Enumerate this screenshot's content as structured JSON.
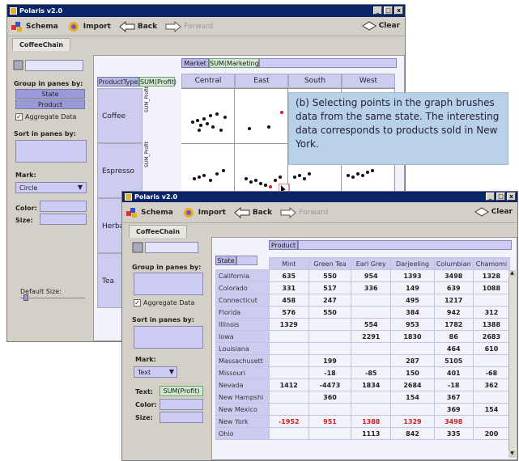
{
  "back_window": {
    "title": "Polaris v2.0",
    "toolbar": {
      "schema": "Schema",
      "import": "Import",
      "back": "Back",
      "forward": "Forward",
      "clear": "Clear"
    },
    "tab": "CoffeeChain",
    "group_label": "Group in panes by:",
    "group_items": [
      "State",
      "Product"
    ],
    "aggregate_label": "Aggregate Data",
    "sort_label": "Sort in panes by:",
    "mark_label": "Mark:",
    "mark_value": "Circle",
    "color_label": "Color:",
    "size_label": "Size:",
    "default_size_label": "Default Size:",
    "shelf_market": "Market",
    "shelf_marketing": "SUM(Marketing)",
    "shelf_producttype": "ProductType",
    "shelf_profit": "SUM(Profit)",
    "columns": [
      "Central",
      "East",
      "South",
      "West"
    ],
    "rows": [
      "Coffee",
      "Espresso",
      "Herbal",
      "Tea"
    ],
    "axis_label": "SUM_Profit"
  },
  "front_window": {
    "title": "Polaris v2.0",
    "toolbar": {
      "schema": "Schema",
      "import": "Import",
      "back": "Back",
      "forward": "Forward",
      "clear": "Clear"
    },
    "tab": "CoffeeChain",
    "group_label": "Group in panes by:",
    "aggregate_label": "Aggregate Data",
    "sort_label": "Sort in panes by:",
    "mark_label": "Mark:",
    "mark_value": "Text",
    "text_label": "Text:",
    "text_field": "SUM(Profit)",
    "color_label": "Color:",
    "size_label": "Size:",
    "shelf_product": "Product",
    "shelf_state": "State",
    "table": {
      "headers": [
        "Mint",
        "Green Tea",
        "Earl Grey",
        "Darjeeling",
        "Columbian",
        "Chamomi"
      ],
      "rows": [
        {
          "state": "California",
          "values": [
            "635",
            "550",
            "954",
            "1393",
            "3498",
            "1328"
          ]
        },
        {
          "state": "Colorado",
          "values": [
            "331",
            "517",
            "336",
            "149",
            "639",
            "1088"
          ]
        },
        {
          "state": "Connecticut",
          "values": [
            "458",
            "247",
            "",
            "495",
            "1217",
            ""
          ]
        },
        {
          "state": "Florida",
          "values": [
            "576",
            "550",
            "",
            "384",
            "942",
            "312"
          ]
        },
        {
          "state": "Illinois",
          "values": [
            "1329",
            "",
            "554",
            "953",
            "1782",
            "1388"
          ]
        },
        {
          "state": "Iowa",
          "values": [
            "",
            "",
            "2291",
            "1830",
            "86",
            "2683"
          ]
        },
        {
          "state": "Louisiana",
          "values": [
            "",
            "",
            "",
            "",
            "464",
            "610"
          ]
        },
        {
          "state": "Massachusett",
          "values": [
            "",
            "199",
            "",
            "287",
            "5105",
            ""
          ]
        },
        {
          "state": "Missouri",
          "values": [
            "",
            "-18",
            "-85",
            "150",
            "401",
            "-68"
          ]
        },
        {
          "state": "Nevada",
          "values": [
            "1412",
            "-4473",
            "1834",
            "2684",
            "-18",
            "362"
          ]
        },
        {
          "state": "New Hampshi",
          "values": [
            "",
            "360",
            "",
            "154",
            "367",
            ""
          ]
        },
        {
          "state": "New Mexico",
          "values": [
            "",
            "",
            "",
            "",
            "369",
            "154"
          ]
        },
        {
          "state": "New York",
          "values": [
            "-1952",
            "951",
            "1388",
            "1329",
            "3498",
            ""
          ]
        },
        {
          "state": "Ohio",
          "values": [
            "",
            "",
            "1113",
            "842",
            "335",
            "200"
          ]
        }
      ]
    }
  },
  "callout": {
    "text": "(b) Selecting points in the graph brushes data from the same state. The interesting data corresponds to products sold in New York."
  },
  "colors": {
    "highlight": "#d02020",
    "shelf": "#ccccf4",
    "titlebar": "#0a246a"
  }
}
